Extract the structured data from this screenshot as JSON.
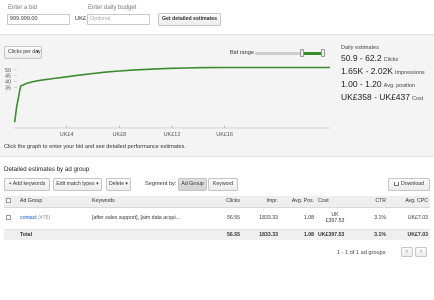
{
  "top": {
    "bid_label": "Enter a bid",
    "bid_value": "999.999.00",
    "currency": "UK£",
    "budget_label": "Enter daily budget",
    "budget_placeholder": "Optional",
    "estimate_button": "Get detailed estimates"
  },
  "graph": {
    "range_select": "Clicks per day",
    "range_arrow": "▾",
    "bid_range_label": "Bid range",
    "bid_range": [
      0.67,
      0.97
    ],
    "hint": "Click the graph to enter your bid and see detailed performance estimates."
  },
  "estimates": {
    "title": "Daily estimates",
    "rows": [
      {
        "value": "50.9 - 62.2",
        "label": "Clicks"
      },
      {
        "value": "1.65K - 2.02K",
        "label": "Impressions"
      },
      {
        "value": "1.00 - 1.20",
        "label": "Avg. position"
      },
      {
        "value": "UK£358 - UK£437",
        "label": "Cost"
      }
    ]
  },
  "chart_data": {
    "type": "line",
    "title": "",
    "xlabel": "",
    "ylabel": "",
    "xlim": [
      0,
      24
    ],
    "ylim": [
      0,
      55
    ],
    "x_ticks": [
      "UK£4",
      "UK£8",
      "UK£12",
      "UK£16"
    ],
    "x_tick_values": [
      4,
      8,
      12,
      16
    ],
    "y_ticks": [
      "50",
      "45",
      "40",
      "35"
    ],
    "y_tick_values": [
      50,
      45,
      40,
      35
    ],
    "series": [
      {
        "color": "#3a8a2e",
        "x": [
          0.05,
          0.2,
          0.5,
          1.0,
          1.5,
          2.0,
          3,
          4,
          5,
          6,
          7,
          8,
          9,
          10,
          11,
          12,
          13,
          14,
          15,
          16,
          17,
          18,
          19,
          20,
          21,
          22,
          23,
          24
        ],
        "y": [
          5,
          18,
          36,
          38.5,
          40,
          41,
          42.5,
          44,
          45.5,
          46.8,
          48,
          49,
          49.8,
          50.4,
          50.9,
          51.3,
          51.6,
          51.8,
          51.9,
          52,
          52,
          52,
          52,
          52,
          52,
          52,
          52,
          52
        ]
      }
    ]
  },
  "table": {
    "heading": "Detailed estimates by ad group",
    "add_keywords": "+ Add keywords",
    "edit_match": "Edit match types ▾",
    "delete": "Delete ▾",
    "segment_label": "Segment by:",
    "segment_ad_group": "Ad Group",
    "segment_keyword": "Keyword",
    "download": "Download",
    "columns": [
      "Ad Group",
      "Keywords",
      "Clicks",
      "Impr.",
      "Avg. Pos.",
      "Cost",
      "CTR",
      "Avg. CPC"
    ],
    "row": {
      "ad_group": "contact",
      "ad_group_count": "(#75)",
      "keywords": "[after sales support], [aim data acqui...",
      "clicks": "56.55",
      "impr": "1833.33",
      "avg_pos": "1.08",
      "cost_line1": "UK",
      "cost_line2": "£397.53",
      "ctr": "3.1%",
      "avg_cpc": "UK£7.03"
    },
    "total": {
      "label": "Total",
      "clicks": "56.55",
      "impr": "1833.33",
      "avg_pos": "1.08",
      "cost": "UK£397.53",
      "ctr": "3.1%",
      "avg_cpc": "UK£7.03"
    },
    "pagination": "1 - 1 of 1 ad groups",
    "prev": "‹",
    "next": "›"
  }
}
